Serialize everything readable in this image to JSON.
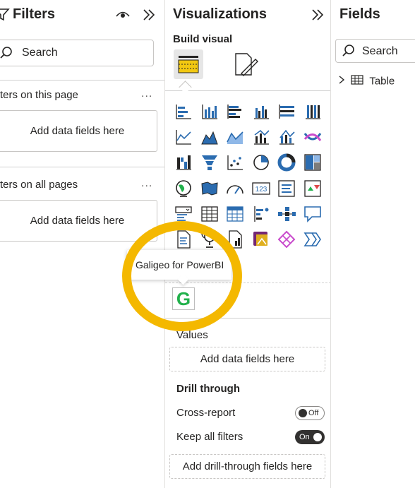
{
  "filters": {
    "title": "Filters",
    "search_placeholder": "Search",
    "sections": [
      {
        "title": "ters on this page",
        "drop_text": "Add data fields here",
        "more": "..."
      },
      {
        "title": "ters on all pages",
        "drop_text": "Add data fields here",
        "more": "..."
      }
    ],
    "icons": [
      "filter-icon",
      "eye-icon",
      "double-chevron-right-icon",
      "search-icon"
    ]
  },
  "visualizations": {
    "title": "Visualizations",
    "build_visual_label": "Build visual",
    "custom_visual_tooltip": "Galigeo for PowerBI",
    "custom_visual_letter": "G",
    "values_label": "Values",
    "values_drop": "Add data fields here",
    "drill_through_title": "Drill through",
    "cross_report_label": "Cross-report",
    "cross_report_state": "Off",
    "keep_filters_label": "Keep all filters",
    "keep_filters_state": "On",
    "drill_drop": "Add drill-through fields here",
    "visual_icons": [
      "stacked-bar-chart-icon",
      "stacked-column-chart-icon",
      "clustered-bar-chart-icon",
      "clustered-column-chart-icon",
      "100-stacked-bar-chart-icon",
      "100-stacked-column-chart-icon",
      "line-chart-icon",
      "area-chart-icon",
      "stacked-area-chart-icon",
      "line-and-column-chart-icon",
      "line-and-stacked-column-chart-icon",
      "ribbon-chart-icon",
      "waterfall-chart-icon",
      "funnel-chart-icon",
      "scatter-chart-icon",
      "pie-chart-icon",
      "donut-chart-icon",
      "treemap-icon",
      "map-icon",
      "filled-map-icon",
      "gauge-icon",
      "card-icon",
      "multi-row-card-icon",
      "kpi-icon",
      "slicer-icon",
      "table-icon",
      "matrix-icon",
      "key-influencers-icon",
      "decomposition-tree-icon",
      "qa-icon",
      "smart-narrative-icon",
      "metrics-icon",
      "paginated-report-icon",
      "power-apps-icon",
      "power-automate-icon",
      "more-visuals-icon"
    ]
  },
  "fields": {
    "title": "Fields",
    "search_placeholder": "Search",
    "table_name": "Table"
  },
  "colors": {
    "accent_yellow": "#f4b800",
    "green": "#22b14c",
    "blue": "#2b6cb0"
  }
}
